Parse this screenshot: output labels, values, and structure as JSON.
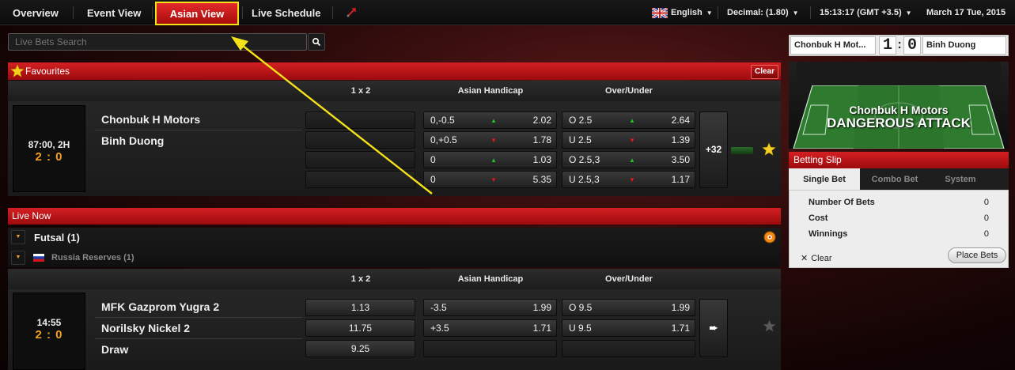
{
  "nav": {
    "items": [
      "Overview",
      "Event View",
      "Asian View",
      "Live Schedule"
    ],
    "active": "Asian View",
    "language": "English",
    "odds_format": "Decimal: (1.80)",
    "time": "15:13:17 (GMT +3.5)",
    "date": "March 17 Tue, 2015"
  },
  "search": {
    "placeholder": "Live Bets Search"
  },
  "favourites": {
    "title": "Favourites",
    "clear_label": "Clear",
    "columns": [
      "1 x 2",
      "Asian Handicap",
      "Over/Under"
    ],
    "match": {
      "time": "87:00, 2H",
      "score": "2 : 0",
      "home": "Chonbuk H Motors",
      "away": "Binh Duong",
      "asian_handicap": [
        {
          "line": "0,-0.5",
          "odds": "2.02",
          "dir": "up"
        },
        {
          "line": "0,+0.5",
          "odds": "1.78",
          "dir": "down"
        },
        {
          "line": "0",
          "odds": "1.03",
          "dir": "up"
        },
        {
          "line": "0",
          "odds": "5.35",
          "dir": "down"
        }
      ],
      "over_under": [
        {
          "line": "O 2.5",
          "odds": "2.64",
          "dir": "up"
        },
        {
          "line": "U 2.5",
          "odds": "1.39",
          "dir": "down"
        },
        {
          "line": "O 2.5,3",
          "odds": "3.50",
          "dir": "up"
        },
        {
          "line": "U 2.5,3",
          "odds": "1.17",
          "dir": "down"
        }
      ],
      "more": "+32"
    }
  },
  "live_now": {
    "title": "Live Now",
    "sport": "Futsal (1)",
    "league": "Russia Reserves (1)",
    "columns": [
      "1 x 2",
      "Asian Handicap",
      "Over/Under"
    ],
    "match": {
      "time": "14:55",
      "score": "2 : 0",
      "home": "MFK Gazprom Yugra 2",
      "away": "Norilsky Nickel 2",
      "draw": "Draw",
      "one_x_two": [
        "1.13",
        "11.75",
        "9.25"
      ],
      "asian_handicap": [
        {
          "line": "-3.5",
          "odds": "1.99"
        },
        {
          "line": "+3.5",
          "odds": "1.71"
        }
      ],
      "over_under": [
        {
          "line": "O 9.5",
          "odds": "1.99"
        },
        {
          "line": "U 9.5",
          "odds": "1.71"
        }
      ]
    }
  },
  "scoreboard": {
    "home": "Chonbuk H Mot...",
    "home_score": "1",
    "away_score": "0",
    "away": "Binh Duong",
    "field_team": "Chonbuk H Motors",
    "field_event": "DANGEROUS ATTACK"
  },
  "betting_slip": {
    "title": "Betting Slip",
    "tabs": [
      "Single Bet",
      "Combo Bet",
      "System"
    ],
    "rows": [
      {
        "label": "Number Of Bets",
        "value": "0"
      },
      {
        "label": "Cost",
        "value": "0"
      },
      {
        "label": "Winnings",
        "value": "0"
      }
    ],
    "clear_label": "Clear",
    "place_label": "Place Bets"
  },
  "colors": {
    "accent_red": "#c8161a",
    "highlight_yellow": "#f3e11a",
    "score_orange": "#f0a020"
  }
}
